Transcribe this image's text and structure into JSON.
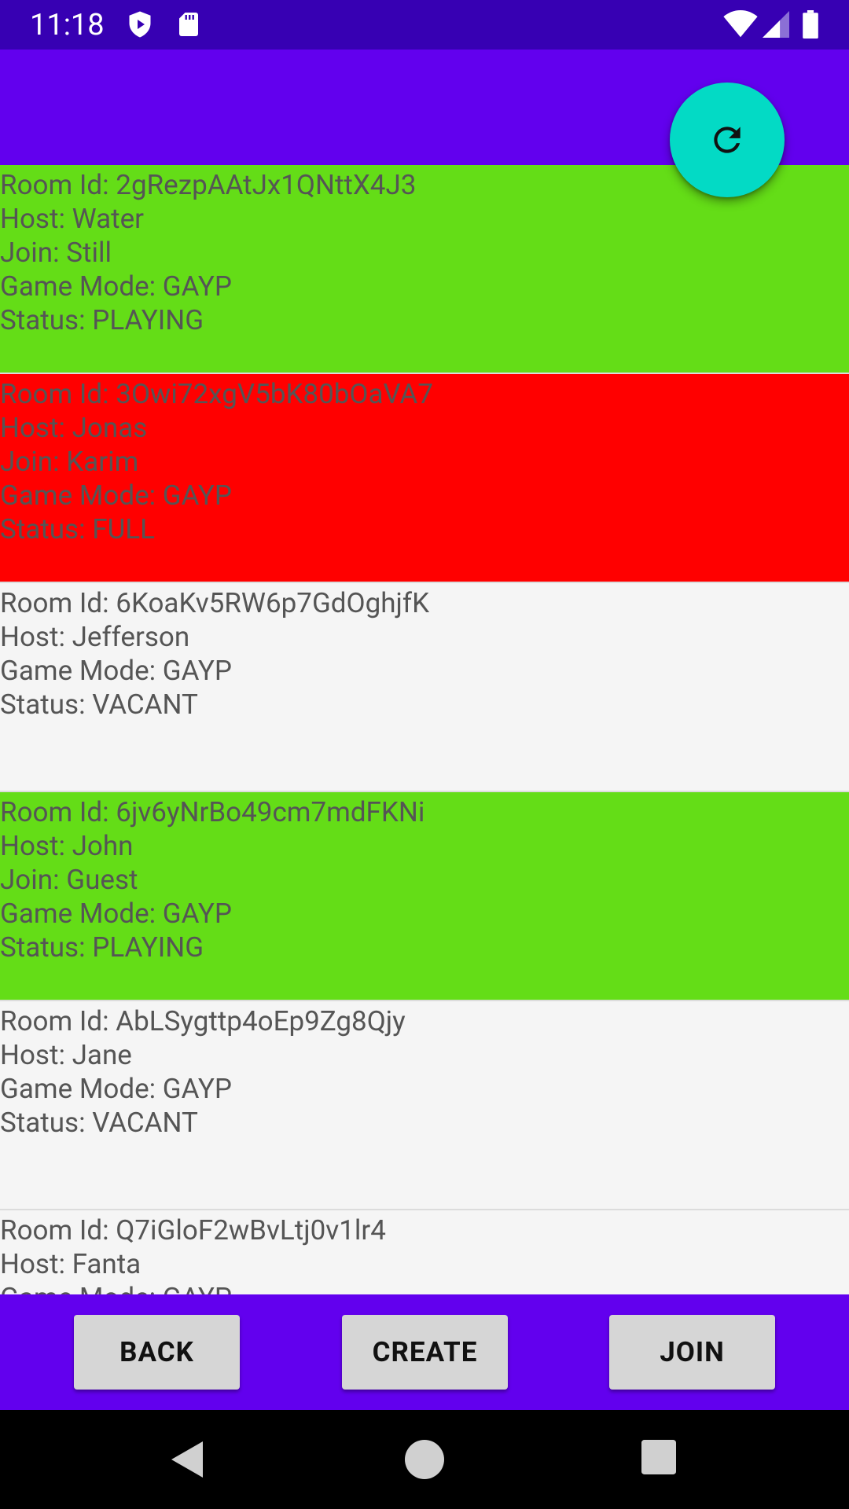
{
  "status_bar": {
    "time": "11:18",
    "icons_left": [
      "play-protect-icon",
      "sd-card-icon"
    ],
    "icons_right": [
      "wifi-icon",
      "signal-icon",
      "battery-icon"
    ]
  },
  "fab": {
    "icon": "refresh-icon"
  },
  "rooms": [
    {
      "color": "#64dd17",
      "lines": [
        "Room Id: 2gRezpAAtJx1QNttX4J3",
        "Host: Water",
        "Join: Still",
        "Game Mode: GAYP",
        "Status: PLAYING"
      ]
    },
    {
      "color": "#ff0000",
      "lines": [
        "Room Id: 3Owi72xgV5bK80bOaVA7",
        "Host: Jonas",
        "Join: Karim",
        "Game Mode: GAYP",
        "Status: FULL"
      ]
    },
    {
      "color": "#f5f5f5",
      "lines": [
        "Room Id: 6KoaKv5RW6p7GdOghjfK",
        "Host: Jefferson",
        "Game Mode: GAYP",
        "Status: VACANT"
      ]
    },
    {
      "color": "#64dd17",
      "lines": [
        "Room Id: 6jv6yNrBo49cm7mdFKNi",
        "Host: John",
        "Join: Guest",
        "Game Mode: GAYP",
        "Status: PLAYING"
      ]
    },
    {
      "color": "#f5f5f5",
      "lines": [
        "Room Id: AbLSygttp4oEp9Zg8Qjy",
        "Host: Jane",
        "Game Mode: GAYP",
        "Status: VACANT"
      ]
    },
    {
      "color": "#f5f5f5",
      "lines": [
        "Room Id: Q7iGloF2wBvLtj0v1lr4",
        "Host: Fanta",
        "Game Mode: GAYP"
      ]
    }
  ],
  "buttons": {
    "back": "BACK",
    "create": "CREATE",
    "join": "JOIN"
  },
  "nav_bar": {
    "icons": [
      "back-nav-icon",
      "home-nav-icon",
      "recents-nav-icon"
    ]
  },
  "colors": {
    "status_bar": "#3700b3",
    "primary": "#6200ee",
    "accent": "#03dac5",
    "playing": "#64dd17",
    "full": "#ff0000",
    "vacant": "#f5f5f5"
  }
}
